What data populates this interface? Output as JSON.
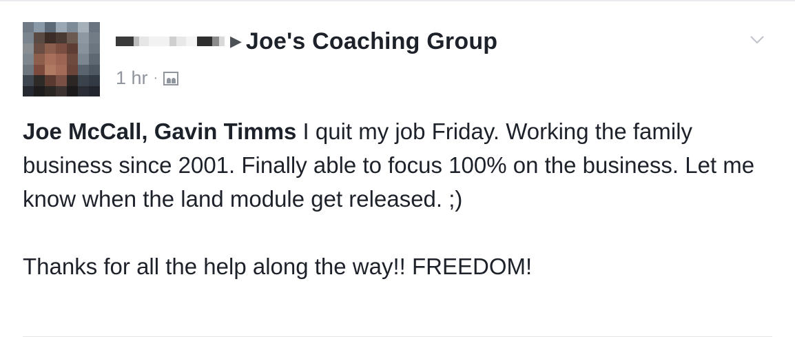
{
  "post": {
    "author_redacted": true,
    "share_arrow": "▶",
    "group_name": "Joe's Coaching Group",
    "timestamp": "1 hr",
    "separator": "·",
    "audience_icon": "group-icon",
    "menu_icon": "chevron-down-icon",
    "tags": {
      "first": "Joe McCall",
      "separator": ", ",
      "second": "Gavin Timms"
    },
    "body_text": " I quit my job Friday. Working the family business since 2001. Finally able to focus 100% on the business. Let me know when the land module get released. ;)",
    "body_text_2": "Thanks for all the help along the way!!  FREEDOM!"
  },
  "colors": {
    "text": "#1d2129",
    "muted": "#90949c",
    "divider": "#e5e5e5"
  }
}
